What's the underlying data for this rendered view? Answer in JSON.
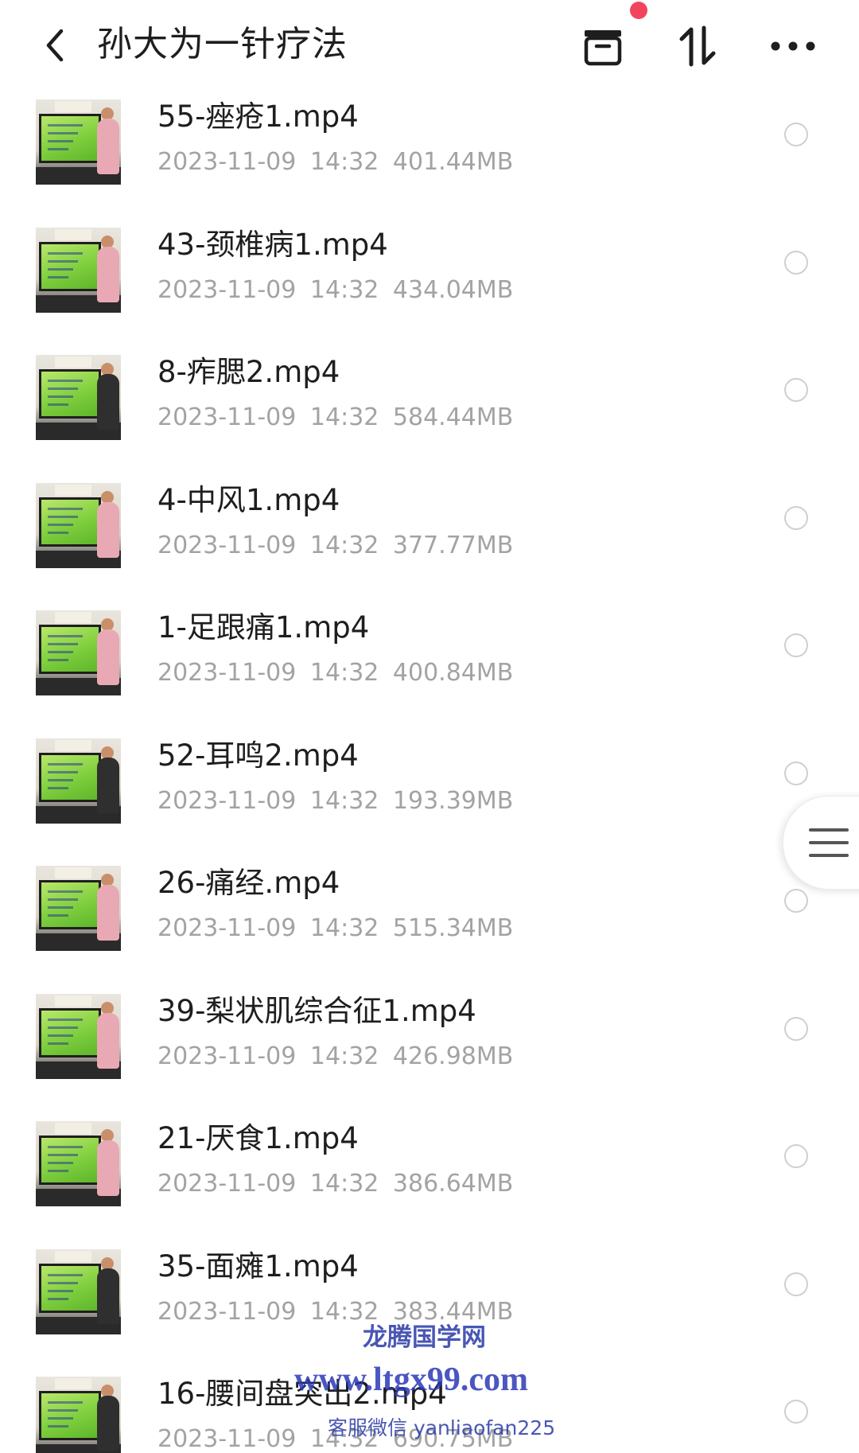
{
  "header": {
    "title": "孙大为一针疗法",
    "back_icon": "chevron-left-icon",
    "actions": [
      "archive-icon",
      "sort-icon",
      "more-icon"
    ],
    "notification_dot_color": "#f2445c"
  },
  "files": [
    {
      "name": "55-痤疮1.mp4",
      "date": "2023-11-09",
      "time": "14:32",
      "size": "401.44MB",
      "presenter": "pink"
    },
    {
      "name": "43-颈椎病1.mp4",
      "date": "2023-11-09",
      "time": "14:32",
      "size": "434.04MB",
      "presenter": "pink"
    },
    {
      "name": "8-痄腮2.mp4",
      "date": "2023-11-09",
      "time": "14:32",
      "size": "584.44MB",
      "presenter": "dark"
    },
    {
      "name": "4-中风1.mp4",
      "date": "2023-11-09",
      "time": "14:32",
      "size": "377.77MB",
      "presenter": "pink"
    },
    {
      "name": "1-足跟痛1.mp4",
      "date": "2023-11-09",
      "time": "14:32",
      "size": "400.84MB",
      "presenter": "pink"
    },
    {
      "name": "52-耳鸣2.mp4",
      "date": "2023-11-09",
      "time": "14:32",
      "size": "193.39MB",
      "presenter": "dark"
    },
    {
      "name": "26-痛经.mp4",
      "date": "2023-11-09",
      "time": "14:32",
      "size": "515.34MB",
      "presenter": "pink"
    },
    {
      "name": "39-梨状肌综合征1.mp4",
      "date": "2023-11-09",
      "time": "14:32",
      "size": "426.98MB",
      "presenter": "pink"
    },
    {
      "name": "21-厌食1.mp4",
      "date": "2023-11-09",
      "time": "14:32",
      "size": "386.64MB",
      "presenter": "pink"
    },
    {
      "name": "35-面瘫1.mp4",
      "date": "2023-11-09",
      "time": "14:32",
      "size": "383.44MB",
      "presenter": "dark"
    },
    {
      "name": "16-腰间盘突出2.mp4",
      "date": "2023-11-09",
      "time": "14:32",
      "size": "690.75MB",
      "presenter": "dark"
    }
  ],
  "side_handle": {
    "icon": "menu-lines-icon"
  },
  "watermark": {
    "line1": "龙腾国学网",
    "line2": "www.ltgx99.com",
    "line3": "客服微信 yanliaofan225"
  },
  "colors": {
    "meta_text": "#a3a3a3",
    "radio_border": "#cfcfcf",
    "watermark": "#2a3aa8"
  }
}
